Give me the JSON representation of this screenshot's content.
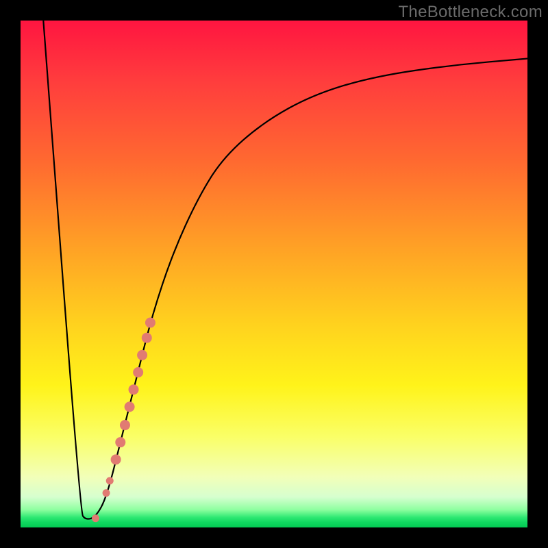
{
  "watermark": "TheBottleneck.com",
  "chart_data": {
    "type": "line",
    "title": "",
    "xlabel": "",
    "ylabel": "",
    "xlim": [
      0,
      100
    ],
    "ylim": [
      0,
      100
    ],
    "series": [
      {
        "name": "bottleneck-curve",
        "points": [
          {
            "x": 4.5,
            "y": 100
          },
          {
            "x": 11.8,
            "y": 3
          },
          {
            "x": 12.8,
            "y": 1.5
          },
          {
            "x": 14.8,
            "y": 2.0
          },
          {
            "x": 17.0,
            "y": 6
          },
          {
            "x": 20.0,
            "y": 18
          },
          {
            "x": 23.0,
            "y": 30
          },
          {
            "x": 26.0,
            "y": 42
          },
          {
            "x": 30.0,
            "y": 54
          },
          {
            "x": 35.0,
            "y": 65
          },
          {
            "x": 40.0,
            "y": 73
          },
          {
            "x": 48.0,
            "y": 80
          },
          {
            "x": 58.0,
            "y": 85.5
          },
          {
            "x": 70.0,
            "y": 89
          },
          {
            "x": 85.0,
            "y": 91.2
          },
          {
            "x": 100.0,
            "y": 92.5
          }
        ]
      }
    ],
    "markers": {
      "name": "highlighted-segment",
      "color": "#e17b72",
      "points": [
        {
          "x": 14.8,
          "y": 1.8,
          "r": 5
        },
        {
          "x": 16.9,
          "y": 6.8,
          "r": 5
        },
        {
          "x": 17.6,
          "y": 9.2,
          "r": 5
        },
        {
          "x": 18.8,
          "y": 13.4,
          "r": 7
        },
        {
          "x": 19.7,
          "y": 16.8,
          "r": 7
        },
        {
          "x": 20.6,
          "y": 20.2,
          "r": 7
        },
        {
          "x": 21.5,
          "y": 23.8,
          "r": 7
        },
        {
          "x": 22.3,
          "y": 27.2,
          "r": 7
        },
        {
          "x": 23.2,
          "y": 30.6,
          "r": 7
        },
        {
          "x": 24.0,
          "y": 34.0,
          "r": 7
        },
        {
          "x": 24.9,
          "y": 37.4,
          "r": 7
        },
        {
          "x": 25.6,
          "y": 40.4,
          "r": 7
        }
      ]
    }
  }
}
